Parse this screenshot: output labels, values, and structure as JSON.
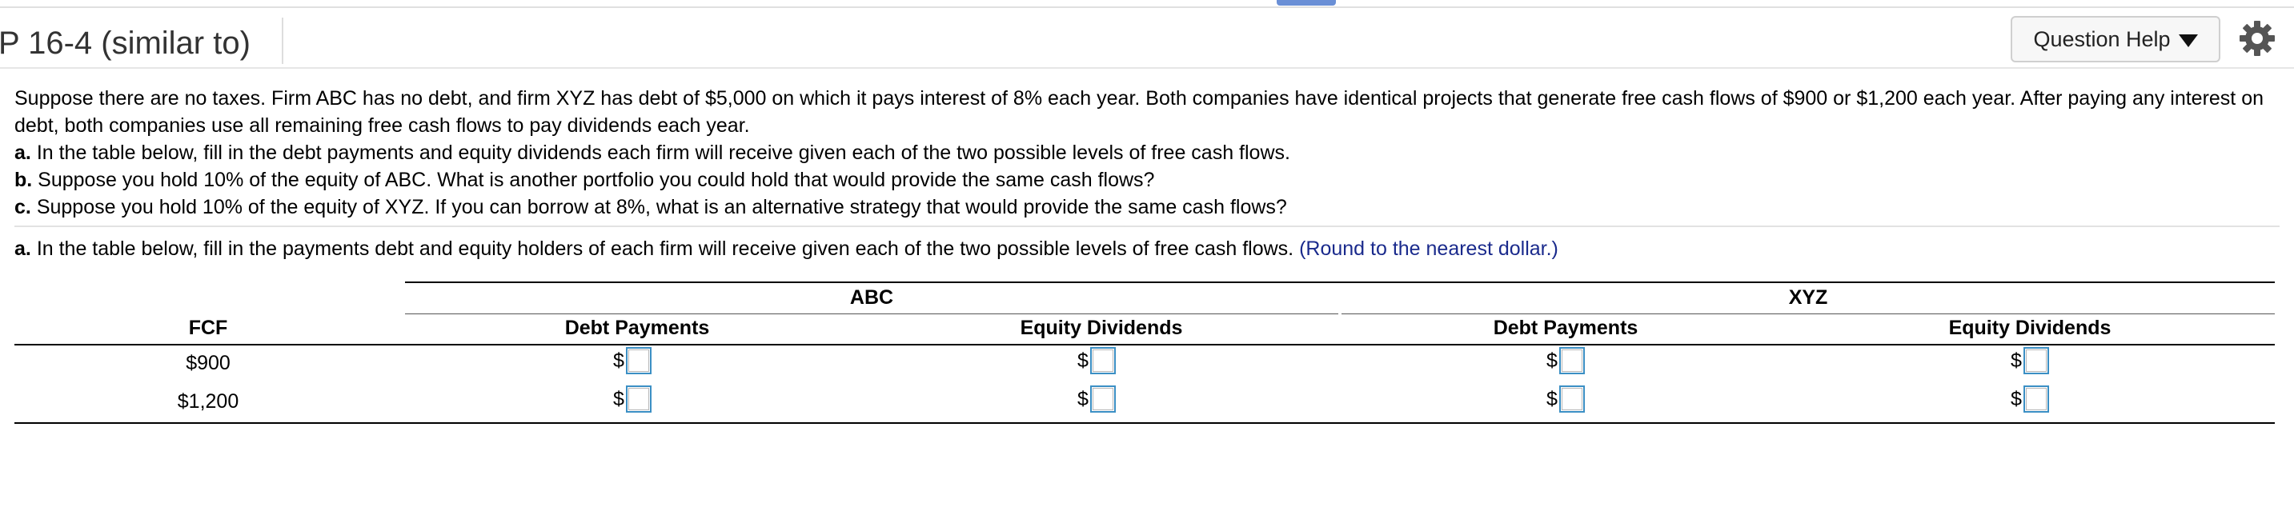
{
  "header": {
    "title": "P 16-4 (similar to)",
    "help_button_label": "Question Help",
    "help_caret_icon": "caret-down-icon",
    "settings_icon": "gear-icon"
  },
  "problem": {
    "intro": "Suppose there are no taxes. Firm ABC has no debt, and firm XYZ has debt of $5,000 on which it pays interest of 8% each year. Both companies have identical projects that generate free cash flows of $900 or $1,200 each year. After paying any interest on debt, both companies use all remaining free cash flows to pay dividends each year.",
    "part_a_label": "a.",
    "part_a_text": "In the table below, fill in the debt payments and equity dividends each firm will receive given each of the two possible levels of free cash flows.",
    "part_b_label": "b.",
    "part_b_text": "Suppose you hold 10% of the equity of ABC. What is another portfolio you could hold that would provide the same cash flows?",
    "part_c_label": "c.",
    "part_c_text": "Suppose you hold 10% of the equity of XYZ. If you can borrow at 8%, what is an alternative strategy that would provide the same cash flows?"
  },
  "question": {
    "label": "a.",
    "text": "In the table below, fill in the payments debt and equity holders of each firm will receive given each of the two possible levels of free cash flows.",
    "hint": "(Round to the nearest dollar.)"
  },
  "table": {
    "groups": [
      "ABC",
      "XYZ"
    ],
    "fcf_header": "FCF",
    "columns": [
      "Debt Payments",
      "Equity Dividends",
      "Debt Payments",
      "Equity Dividends"
    ],
    "rows": [
      {
        "fcf": "$900",
        "currency": "$",
        "values": [
          "",
          "",
          "",
          ""
        ]
      },
      {
        "fcf": "$1,200",
        "currency": "$",
        "values": [
          "",
          "",
          "",
          ""
        ]
      }
    ]
  },
  "colors": {
    "accent": "#6a8fd6",
    "input_border": "#3b8fc4",
    "hint_text": "#1a2a8c"
  }
}
